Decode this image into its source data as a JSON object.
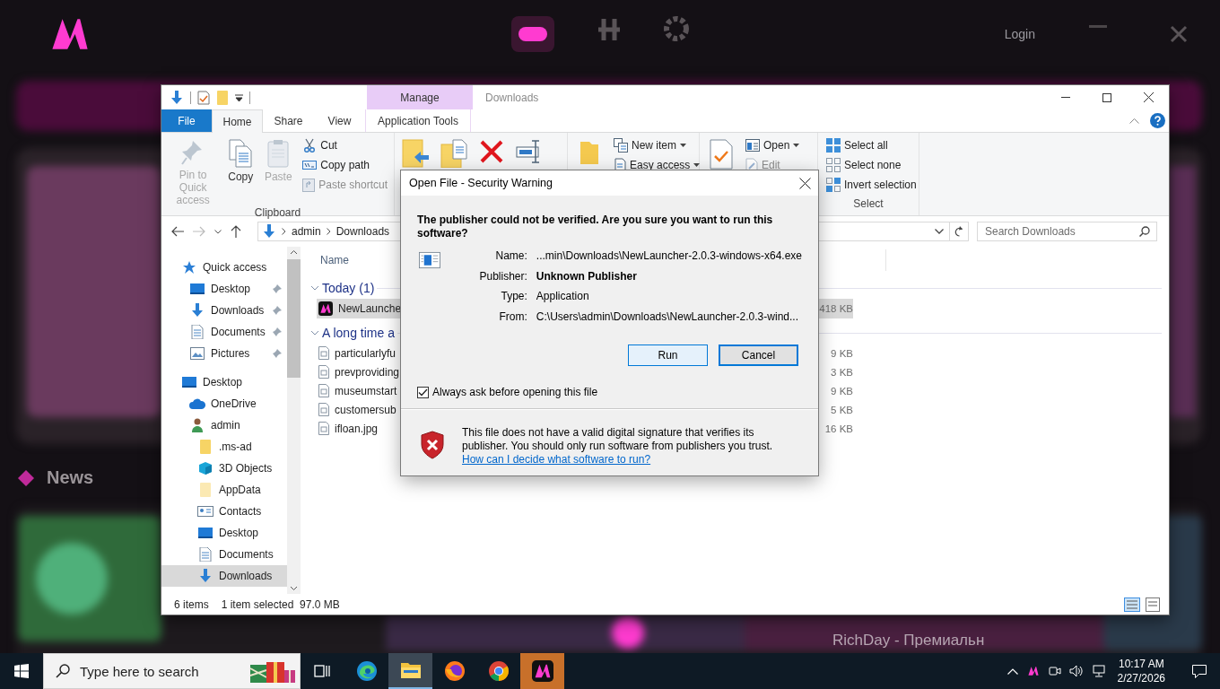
{
  "background_app": {
    "login": "Login",
    "section_title": "News",
    "card_title": "RichDay - Премиальн"
  },
  "explorer": {
    "title": "Downloads",
    "context_tab": {
      "group": "Manage",
      "label": "Application Tools",
      "selected": false
    },
    "tabs": [
      {
        "label": "File",
        "kind": "file",
        "selected": false
      },
      {
        "label": "Home",
        "kind": "plain",
        "selected": true
      },
      {
        "label": "Share",
        "kind": "plain",
        "selected": false
      },
      {
        "label": "View",
        "kind": "plain",
        "selected": false
      }
    ],
    "ribbon": [
      {
        "title": "Clipboard",
        "items": [
          {
            "kind": "pin",
            "label": "Pin to Quick access",
            "disabled": true
          },
          {
            "kind": "copy",
            "label": "Copy",
            "disabled": false
          },
          {
            "kind": "paste",
            "label": "Paste",
            "disabled": true
          },
          {
            "kind": "cut",
            "label": "Cut",
            "disabled": false
          },
          {
            "kind": "copy-path",
            "label": "Copy path",
            "disabled": false
          },
          {
            "kind": "paste-shortcut",
            "label": "Paste shortcut",
            "disabled": true
          }
        ]
      },
      {
        "items": [
          {
            "kind": "move-to",
            "disabled": false
          },
          {
            "kind": "copy-to",
            "disabled": false
          },
          {
            "kind": "delete",
            "disabled": false
          },
          {
            "kind": "rename",
            "disabled": false
          }
        ]
      },
      {
        "items": [
          {
            "kind": "new-folder",
            "disabled": false
          },
          {
            "kind": "new-item",
            "label": "New item",
            "disabled": false
          },
          {
            "kind": "easy-access",
            "label": "Easy access",
            "disabled": false
          }
        ]
      },
      {
        "items": [
          {
            "kind": "properties",
            "disabled": false
          },
          {
            "kind": "open",
            "label": "Open",
            "disabled": false
          },
          {
            "kind": "edit",
            "label": "Edit",
            "disabled": true
          }
        ]
      },
      {
        "title": "Select",
        "items": [
          {
            "kind": "select-all",
            "label": "Select all",
            "disabled": false
          },
          {
            "kind": "select-none",
            "label": "Select none",
            "disabled": false
          },
          {
            "kind": "invert",
            "label": "Invert selection",
            "disabled": false
          }
        ]
      }
    ],
    "address": {
      "path": [
        "admin",
        "Downloads"
      ],
      "search_placeholder": "Search Downloads"
    },
    "nav": [
      {
        "label": "Quick access",
        "kind": "star",
        "selected": false,
        "children": [
          {
            "label": "Desktop",
            "kind": "desktop",
            "selected": false,
            "pinned": true
          },
          {
            "label": "Downloads",
            "kind": "download",
            "selected": false,
            "pinned": true
          },
          {
            "label": "Documents",
            "kind": "document",
            "selected": false,
            "pinned": true
          },
          {
            "label": "Pictures",
            "kind": "picture",
            "selected": false,
            "pinned": true
          }
        ]
      },
      {
        "label": "Desktop",
        "kind": "desktop",
        "selected": false,
        "children": [
          {
            "label": "OneDrive",
            "kind": "cloud",
            "selected": false
          },
          {
            "label": "admin",
            "kind": "user",
            "selected": false,
            "children": [
              {
                "label": ".ms-ad",
                "kind": "folder",
                "selected": false
              },
              {
                "label": "3D Objects",
                "kind": "cube",
                "selected": false
              },
              {
                "label": "AppData",
                "kind": "folder-light",
                "selected": false
              },
              {
                "label": "Contacts",
                "kind": "contacts",
                "selected": false
              },
              {
                "label": "Desktop",
                "kind": "desktop",
                "selected": false
              },
              {
                "label": "Documents",
                "kind": "document",
                "selected": false
              },
              {
                "label": "Downloads",
                "kind": "download",
                "selected": true
              }
            ]
          }
        ]
      }
    ],
    "files": {
      "column": "Name",
      "groups": [
        {
          "label": "Today (1)",
          "expanded": true,
          "files": [
            {
              "name": "NewLaunche",
              "size": "418 KB",
              "kind": "app",
              "selected": true
            }
          ]
        },
        {
          "label": "A long time a",
          "expanded": true,
          "files": [
            {
              "name": "particularlyfu",
              "size": "9 KB",
              "kind": "file",
              "selected": false
            },
            {
              "name": "prevproviding",
              "size": "3 KB",
              "kind": "file",
              "selected": false
            },
            {
              "name": "museumstart",
              "size": "9 KB",
              "kind": "file",
              "selected": false
            },
            {
              "name": "customersub",
              "size": "5 KB",
              "kind": "file",
              "selected": false
            },
            {
              "name": "ifloan.jpg",
              "size": "16 KB",
              "kind": "file",
              "selected": false
            }
          ]
        }
      ]
    },
    "status": {
      "count": "6 items",
      "selection": "1 item selected",
      "size": "97.0 MB"
    }
  },
  "dialog": {
    "title": "Open File - Security Warning",
    "heading": "The publisher could not be verified.  Are you sure you want to run this software?",
    "fields": [
      {
        "label": "Name:",
        "value": "...min\\Downloads\\NewLauncher-2.0.3-windows-x64.exe",
        "strong": false
      },
      {
        "label": "Publisher:",
        "value": "Unknown Publisher",
        "strong": true
      },
      {
        "label": "Type:",
        "value": "Application",
        "strong": false
      },
      {
        "label": "From:",
        "value": "C:\\Users\\admin\\Downloads\\NewLauncher-2.0.3-wind...",
        "strong": false
      }
    ],
    "buttons": [
      {
        "label": "Run",
        "default": false,
        "hovered": true
      },
      {
        "label": "Cancel",
        "default": true,
        "hovered": false
      }
    ],
    "checkbox": {
      "label": "Always ask before opening this file",
      "checked": true
    },
    "footer": "This file does not have a valid digital signature that verifies its publisher.  You should only run software from publishers you trust.",
    "link": "How can I decide what software to run?"
  },
  "taskbar": {
    "search_placeholder": "Type here to search",
    "apps": [
      {
        "kind": "task-view",
        "active": false,
        "flashing": false
      },
      {
        "kind": "edge",
        "active": false,
        "flashing": false
      },
      {
        "kind": "explorer",
        "active": true,
        "flashing": false
      },
      {
        "kind": "firefox",
        "active": false,
        "flashing": false
      },
      {
        "kind": "chrome",
        "active": false,
        "flashing": false
      },
      {
        "kind": "launcher",
        "active": false,
        "flashing": true
      }
    ],
    "time": "10:17 AM",
    "date": "2/27/2026"
  }
}
